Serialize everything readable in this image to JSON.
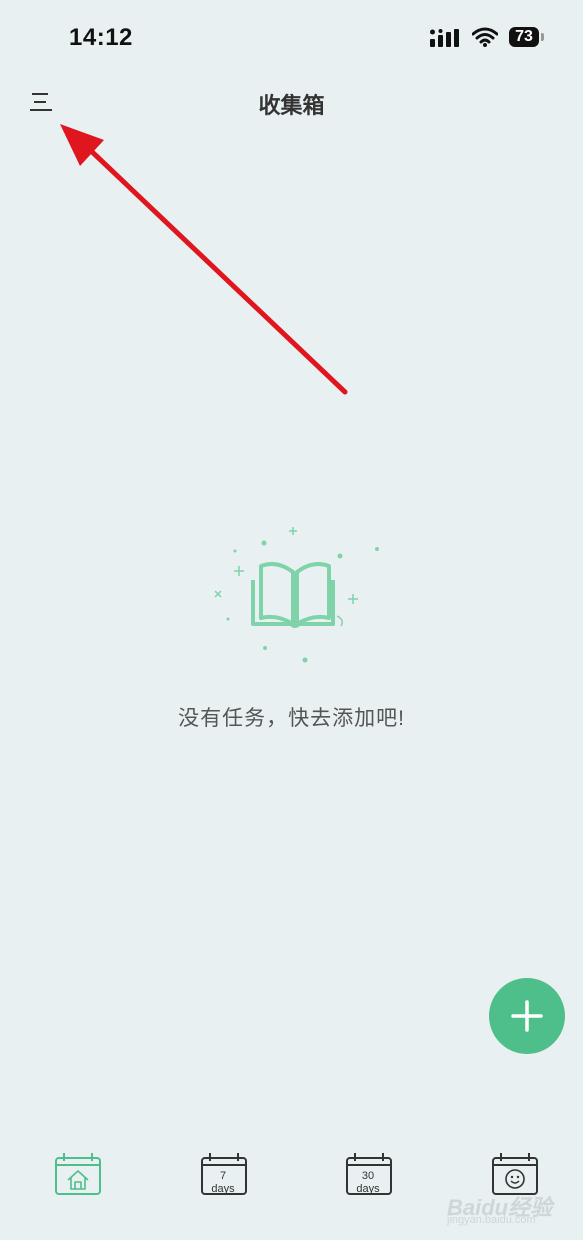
{
  "status_bar": {
    "time": "14:12",
    "battery": "73",
    "icons": [
      "signal-icon",
      "wifi-icon",
      "battery-icon"
    ]
  },
  "header": {
    "title": "收集箱",
    "menu_icon": "menu-icon"
  },
  "empty_state": {
    "illustration": "open-book-icon",
    "message": "没有任务，快去添加吧!"
  },
  "fab": {
    "icon": "plus-icon"
  },
  "bottom_nav": {
    "items": [
      {
        "id": "home",
        "icon": "home-calendar-icon",
        "label": ""
      },
      {
        "id": "7days",
        "icon": "calendar-icon",
        "line1": "7",
        "line2": "days"
      },
      {
        "id": "30days",
        "icon": "calendar-icon",
        "line1": "30",
        "line2": "days"
      },
      {
        "id": "mood",
        "icon": "smiley-calendar-icon",
        "label": ""
      }
    ]
  },
  "watermark": {
    "text": "Baidu经验",
    "sub": "jingyan.baidu.com"
  },
  "colors": {
    "accent": "#4ebf8b",
    "arrow": "#e0161f",
    "background": "#e9f0f1"
  }
}
